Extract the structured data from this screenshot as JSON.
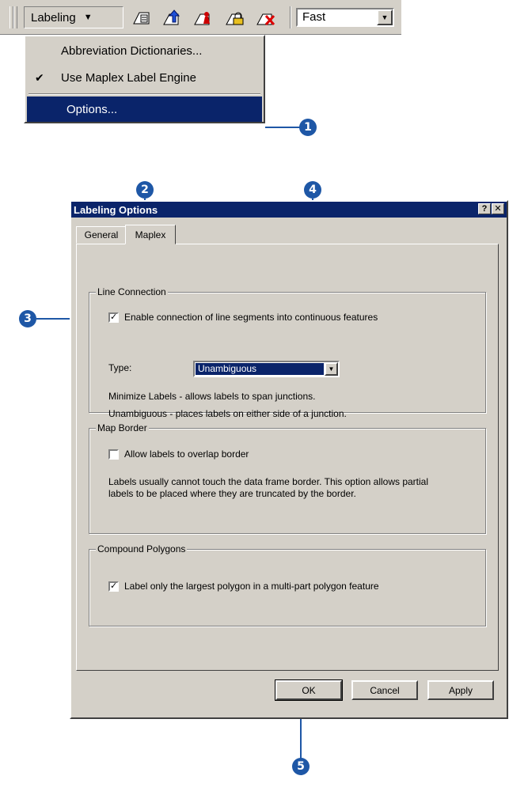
{
  "toolbar": {
    "labeling_menu_label": "Labeling",
    "labeling_arrow": "▼",
    "quality_combo_value": "Fast",
    "icons": [
      "label-manager-icon",
      "label-priority-icon",
      "label-weights-icon",
      "lock-labels-icon",
      "view-unplaced-labels-icon"
    ]
  },
  "menu": {
    "items": [
      {
        "label": "Abbreviation Dictionaries...",
        "checked": false
      },
      {
        "label": "Use Maplex Label Engine",
        "checked": true
      },
      {
        "label": "Options...",
        "selected": true
      }
    ],
    "check_glyph": "✔"
  },
  "callouts": {
    "c1": "1",
    "c2": "2",
    "c3": "3",
    "c4": "4",
    "c5": "5"
  },
  "dialog": {
    "title": "Labeling Options",
    "help_glyph": "?",
    "close_glyph": "✕",
    "tabs": [
      "General",
      "Maplex"
    ],
    "line_connection": {
      "title": "Line Connection",
      "enable_label": "Enable connection of line segments into continuous features",
      "enable_checked": true,
      "type_label": "Type:",
      "type_value": "Unambiguous",
      "desc1": "Minimize Labels - allows labels to span junctions.",
      "desc2": "Unambiguous - places labels on either side of a junction."
    },
    "map_border": {
      "title": "Map Border",
      "allow_label": "Allow labels to overlap border",
      "allow_checked": false,
      "desc": "Labels usually cannot touch the data frame border. This option allows partial labels to be placed where they are truncated by the border."
    },
    "compound_polygons": {
      "title": "Compound Polygons",
      "largest_label": "Label only the largest polygon in a multi-part polygon feature",
      "largest_checked": true
    },
    "buttons": {
      "ok": "OK",
      "cancel": "Cancel",
      "apply": "Apply"
    }
  },
  "colors": {
    "callout": "#1e57a6",
    "titlebar": "#0a246a",
    "face": "#d4d0c8"
  }
}
